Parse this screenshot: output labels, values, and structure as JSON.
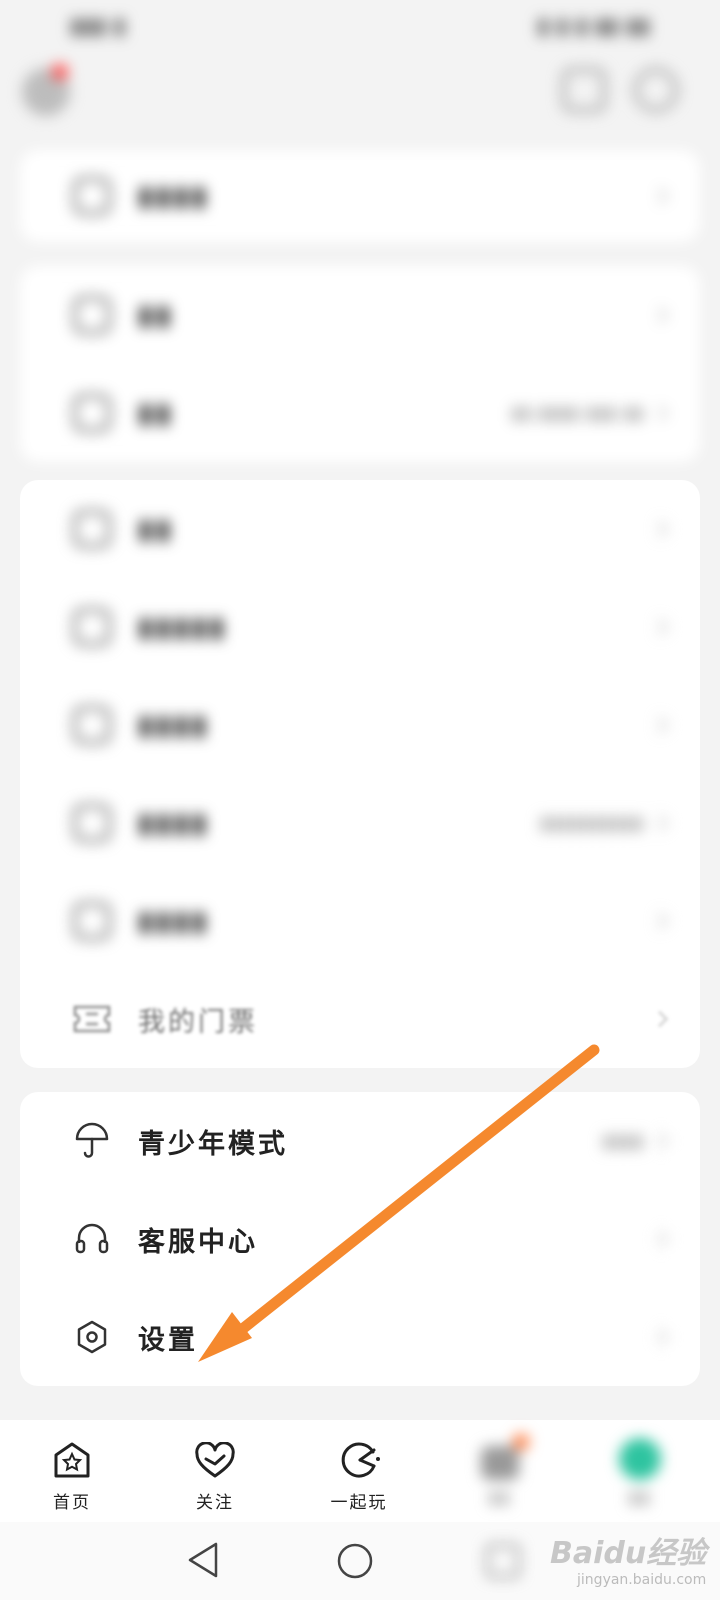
{
  "status_bar": {
    "left_text": "",
    "right_text": ""
  },
  "top_bar": {
    "has_notification_dot": true
  },
  "cards": [
    {
      "rows": [
        {
          "id": "creator-center",
          "label": "",
          "value": "",
          "icon": "edit-icon"
        }
      ]
    },
    {
      "rows": [
        {
          "id": "wallet",
          "label": "",
          "value": "",
          "icon": "wallet-icon"
        },
        {
          "id": "orders",
          "label": "",
          "value": "",
          "icon": "order-icon"
        }
      ]
    },
    {
      "rows": [
        {
          "id": "history",
          "label": "",
          "value": "",
          "icon": "clock-icon"
        },
        {
          "id": "favorites",
          "label": "",
          "value": "",
          "icon": "star-icon"
        },
        {
          "id": "item-3",
          "label": "",
          "value": "",
          "icon": "people-icon"
        },
        {
          "id": "item-4",
          "label": "",
          "value": "",
          "icon": "card-icon"
        },
        {
          "id": "item-5",
          "label": "",
          "value": "",
          "icon": "bag-icon"
        },
        {
          "id": "my-tickets",
          "label": "我的门票",
          "value": "",
          "icon": "ticket-icon"
        }
      ]
    },
    {
      "rows": [
        {
          "id": "teen-mode",
          "label": "青少年模式",
          "value": "",
          "icon": "umbrella-icon"
        },
        {
          "id": "customer-service",
          "label": "客服中心",
          "value": "",
          "icon": "headset-icon"
        },
        {
          "id": "settings",
          "label": "设置",
          "value": "",
          "icon": "gear-icon"
        }
      ]
    }
  ],
  "bottom_nav": [
    {
      "id": "home",
      "label": "首页",
      "icon": "home-icon"
    },
    {
      "id": "follow",
      "label": "关注",
      "icon": "heart-icon"
    },
    {
      "id": "play",
      "label": "一起玩",
      "icon": "gamepad-icon"
    },
    {
      "id": "messages",
      "label": "",
      "icon": "message-icon"
    },
    {
      "id": "me",
      "label": "",
      "icon": "avatar-icon"
    }
  ],
  "annotation": {
    "arrow_color": "#f5892e",
    "points_to": "settings"
  },
  "watermark": {
    "brand": "Baidu经验",
    "url": "jingyan.baidu.com"
  },
  "colors": {
    "background": "#f3f3f3",
    "card": "#ffffff",
    "notification_dot": "#ff4a4a",
    "green_avatar": "#2ec4a0"
  }
}
